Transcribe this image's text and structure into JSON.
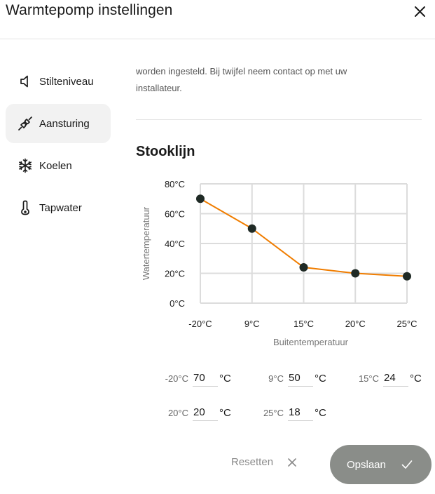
{
  "window": {
    "title": "Warmtepomp instellingen"
  },
  "sidebar": {
    "items": [
      {
        "label": "Stilteniveau",
        "icon": "speaker-icon"
      },
      {
        "label": "Aansturing",
        "icon": "plug-icon",
        "active": true
      },
      {
        "label": "Koelen",
        "icon": "snowflake-icon"
      },
      {
        "label": "Tapwater",
        "icon": "thermometer-icon"
      }
    ]
  },
  "main": {
    "intro_line1": "worden ingesteld. Bij twijfel neem contact op met uw",
    "intro_line2": "installateur.",
    "section_title": "Stooklijn"
  },
  "chart_data": {
    "type": "line",
    "title": "",
    "xlabel": "Buitentemperatuur",
    "ylabel": "Watertemperatuur",
    "categories": [
      "-20°C",
      "9°C",
      "15°C",
      "20°C",
      "25°C"
    ],
    "y_ticks": [
      "80°C",
      "60°C",
      "40°C",
      "20°C",
      "0°C"
    ],
    "ylim": [
      0,
      80
    ],
    "grid": true,
    "series": [
      {
        "values": [
          70,
          50,
          24,
          20,
          18
        ],
        "color": "#f07d00"
      }
    ]
  },
  "fields": [
    {
      "label": "-20°C",
      "value": "70",
      "unit": "°C"
    },
    {
      "label": "9°C",
      "value": "50",
      "unit": "°C"
    },
    {
      "label": "15°C",
      "value": "24",
      "unit": "°C"
    },
    {
      "label": "20°C",
      "value": "20",
      "unit": "°C"
    },
    {
      "label": "25°C",
      "value": "18",
      "unit": "°C"
    }
  ],
  "footer": {
    "reset_label": "Resetten",
    "save_label": "Opslaan"
  },
  "colors": {
    "line": "#f07d00",
    "point": "#1f2a25",
    "save_button": "#8a8d89",
    "active_item": "#f2f2f2"
  }
}
